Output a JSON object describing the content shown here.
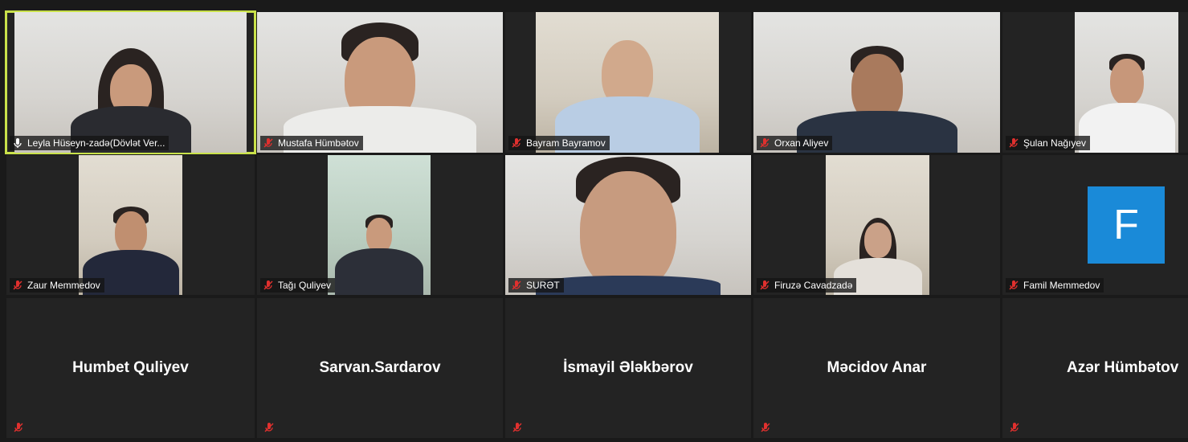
{
  "participants_row1": [
    {
      "name": "Leyla Hüseyn-zadə(Dövlət Ver...",
      "muted": false,
      "active": true
    },
    {
      "name": "Mustafa Hümbətov",
      "muted": true
    },
    {
      "name": "Bayram Bayramov",
      "muted": true
    },
    {
      "name": "Orxan Aliyev",
      "muted": true
    },
    {
      "name": "Şulan Nağıyev",
      "muted": true
    }
  ],
  "participants_row2": [
    {
      "name": "Zaur Memmedov",
      "muted": true
    },
    {
      "name": "Tağı Quliyev",
      "muted": true
    },
    {
      "name": "SURƏT",
      "muted": true
    },
    {
      "name": "Firuzə Cavadzadə",
      "muted": true
    },
    {
      "name": "Famil Memmedov",
      "muted": true,
      "avatar_letter": "F"
    }
  ],
  "participants_row3": [
    {
      "name": "Humbet Quliyev"
    },
    {
      "name": "Sarvan.Sardarov"
    },
    {
      "name": "İsmayil Ələkbərov"
    },
    {
      "name": "Məcidov Anar"
    },
    {
      "name": "Azər Hümbətov"
    }
  ],
  "colors": {
    "active_border": "#c9e14a",
    "avatar_bg": "#1a8ad8",
    "muted_icon": "#e0302e"
  },
  "icons": {
    "muted": "mic-muted-icon",
    "unmuted": "mic-active-icon"
  }
}
